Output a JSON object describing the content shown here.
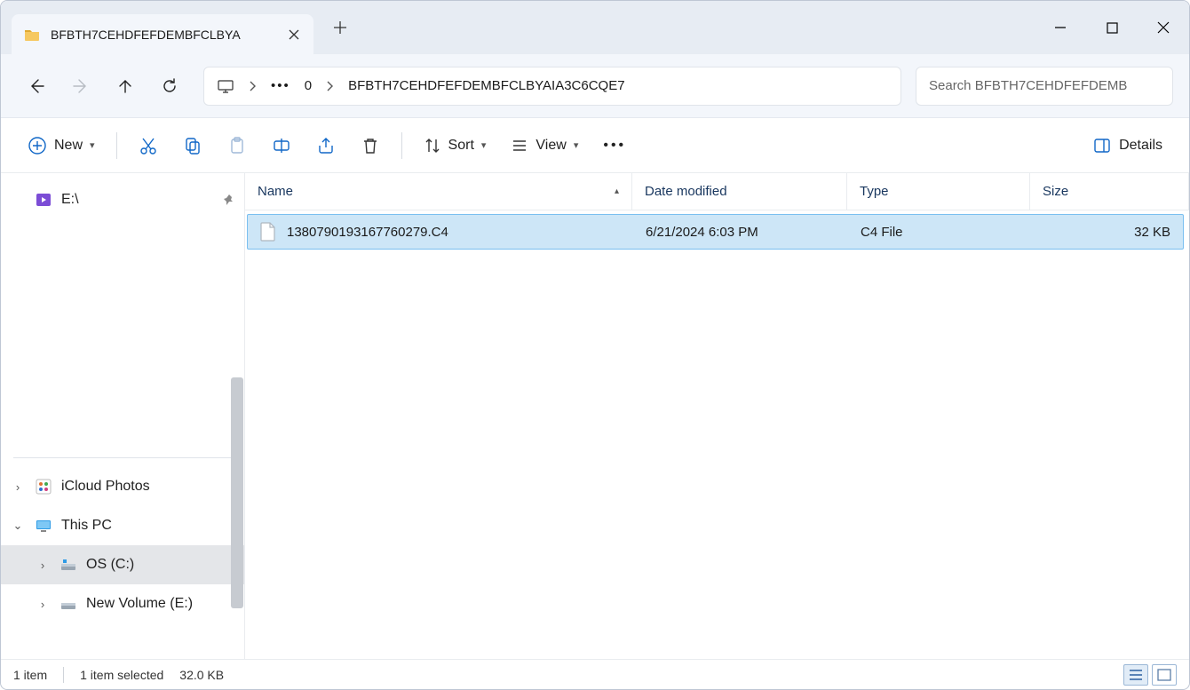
{
  "tab": {
    "title": "BFBTH7CEHDFEFDEMBFCLBYA"
  },
  "address": {
    "crumb1": "0",
    "crumb2": "BFBTH7CEHDFEFDEMBFCLBYAIA3C6CQE7"
  },
  "search": {
    "placeholder": "Search BFBTH7CEHDFEFDEMB"
  },
  "toolbar": {
    "new_label": "New",
    "sort_label": "Sort",
    "view_label": "View",
    "details_label": "Details"
  },
  "columns": {
    "name": "Name",
    "date": "Date modified",
    "type": "Type",
    "size": "Size"
  },
  "sidebar": {
    "e_drive": "E:\\",
    "icloud": "iCloud Photos",
    "this_pc": "This PC",
    "os_c": "OS (C:)",
    "new_vol_e": "New Volume (E:)"
  },
  "files": [
    {
      "name": "1380790193167760279.C4",
      "date": "6/21/2024 6:03 PM",
      "type": "C4 File",
      "size": "32 KB"
    }
  ],
  "status": {
    "count": "1 item",
    "selected": "1 item selected",
    "size": "32.0 KB"
  }
}
